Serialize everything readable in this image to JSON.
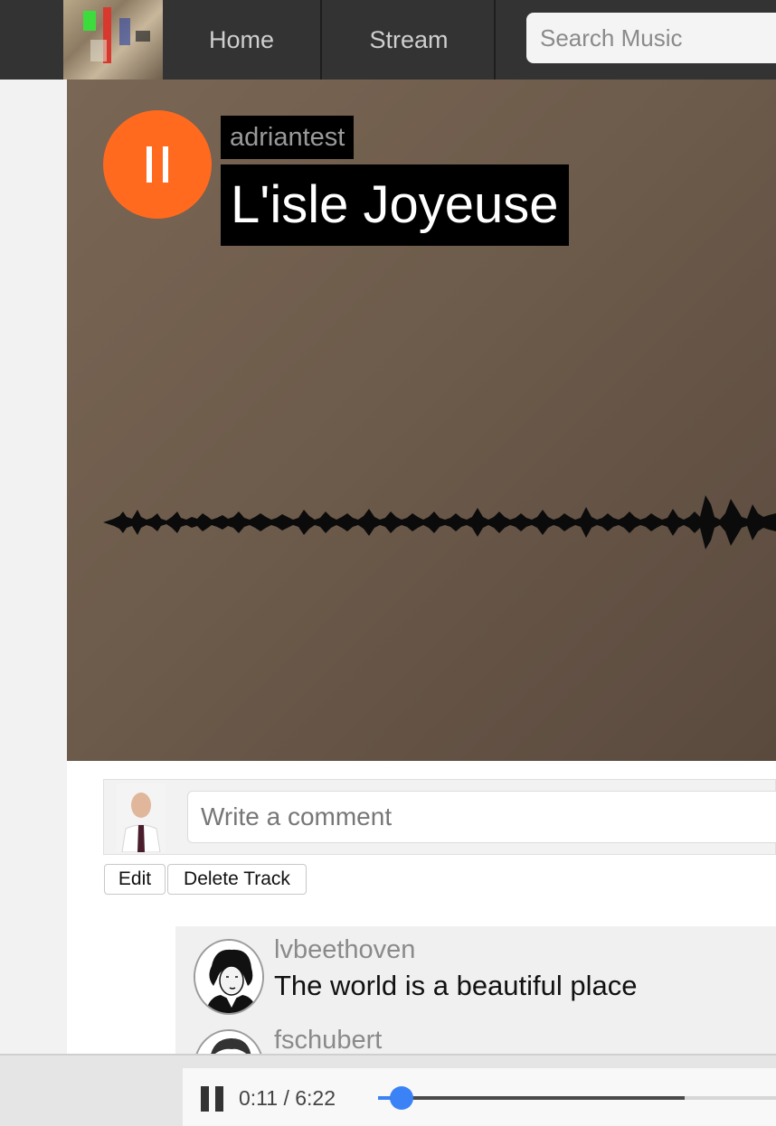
{
  "nav": {
    "logo_icon": "abstract-artwork-logo",
    "home_label": "Home",
    "stream_label": "Stream",
    "search_placeholder": "Search Music"
  },
  "track": {
    "artist": "adriantest",
    "title": "L'isle Joyeuse",
    "is_playing": true,
    "play_button_icon": "pause-icon",
    "accent_color": "#ff6a1f"
  },
  "comment_form": {
    "avatar_icon": "user-avatar",
    "placeholder": "Write a comment"
  },
  "actions": {
    "edit_label": "Edit",
    "delete_label": "Delete Track"
  },
  "comments": [
    {
      "username": "lvbeethoven",
      "text": "The world is a beautiful place",
      "avatar_icon": "beethoven-portrait"
    },
    {
      "username": "fschubert",
      "text": "",
      "avatar_icon": "schubert-portrait"
    }
  ],
  "player": {
    "current_time": "0:11",
    "separator": "/",
    "duration": "6:22",
    "progress_fraction": 0.029,
    "buffered_fraction": 0.77,
    "progress_color": "#3b82f6"
  }
}
